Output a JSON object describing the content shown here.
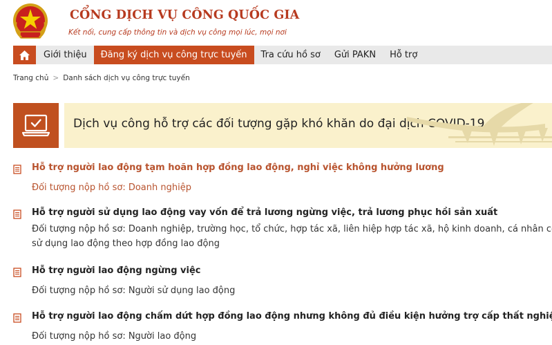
{
  "header": {
    "title": "CỔNG DỊCH VỤ CÔNG QUỐC GIA",
    "tagline": "Kết nối, cung cấp thông tin và dịch vụ công mọi lúc, mọi nơi",
    "emblem_icon": "national-emblem-icon"
  },
  "nav": {
    "home_icon": "home-icon",
    "items": [
      {
        "label": "Giới thiệu"
      },
      {
        "label": "Đăng ký dịch vụ công trực tuyến",
        "active": true
      },
      {
        "label": "Tra cứu hồ sơ"
      },
      {
        "label": "Gửi PAKN"
      },
      {
        "label": "Hỗ trợ"
      }
    ]
  },
  "breadcrumb": {
    "home": "Trang chủ",
    "separator": ">",
    "current": "Danh sách dịch vụ công trực tuyến"
  },
  "banner": {
    "icon": "laptop-check-icon",
    "title": "Dịch vụ công hỗ trợ các đối tượng gặp khó khăn do đại dịch COVID-19"
  },
  "services": [
    {
      "title": "Hỗ trợ người lao động tạm hoãn hợp đồng lao động, nghỉ việc không hưởng lương",
      "subject": "Đối tượng nộp hồ sơ: Doanh nghiệp",
      "subject_line2": ""
    },
    {
      "title": "Hỗ trợ người sử dụng lao động vay vốn để trả lương ngừng việc, trả lương phục hồi sản xuất",
      "subject": "Đối tượng nộp hồ sơ: Doanh nghiệp, trường học, tổ chức, hợp tác xã, liên hiệp hợp tác xã, hộ kinh doanh, cá nhân có",
      "subject_line2": "sử dụng lao động theo hợp đồng lao động"
    },
    {
      "title": "Hỗ trợ người lao động ngừng việc",
      "subject": "Đối tượng nộp hồ sơ: Người sử dụng lao động",
      "subject_line2": ""
    },
    {
      "title": "Hỗ trợ người lao động chấm dứt hợp đồng lao động nhưng không đủ điều kiện hưởng trợ cấp thất nghiệp",
      "subject": "Đối tượng nộp hồ sơ: Người lao động",
      "subject_line2": ""
    }
  ],
  "colors": {
    "brand": "#c84c1f",
    "highlight_text": "#b8532e",
    "banner_bg": "#faf1cc",
    "nav_bg": "#e9e9e9"
  }
}
